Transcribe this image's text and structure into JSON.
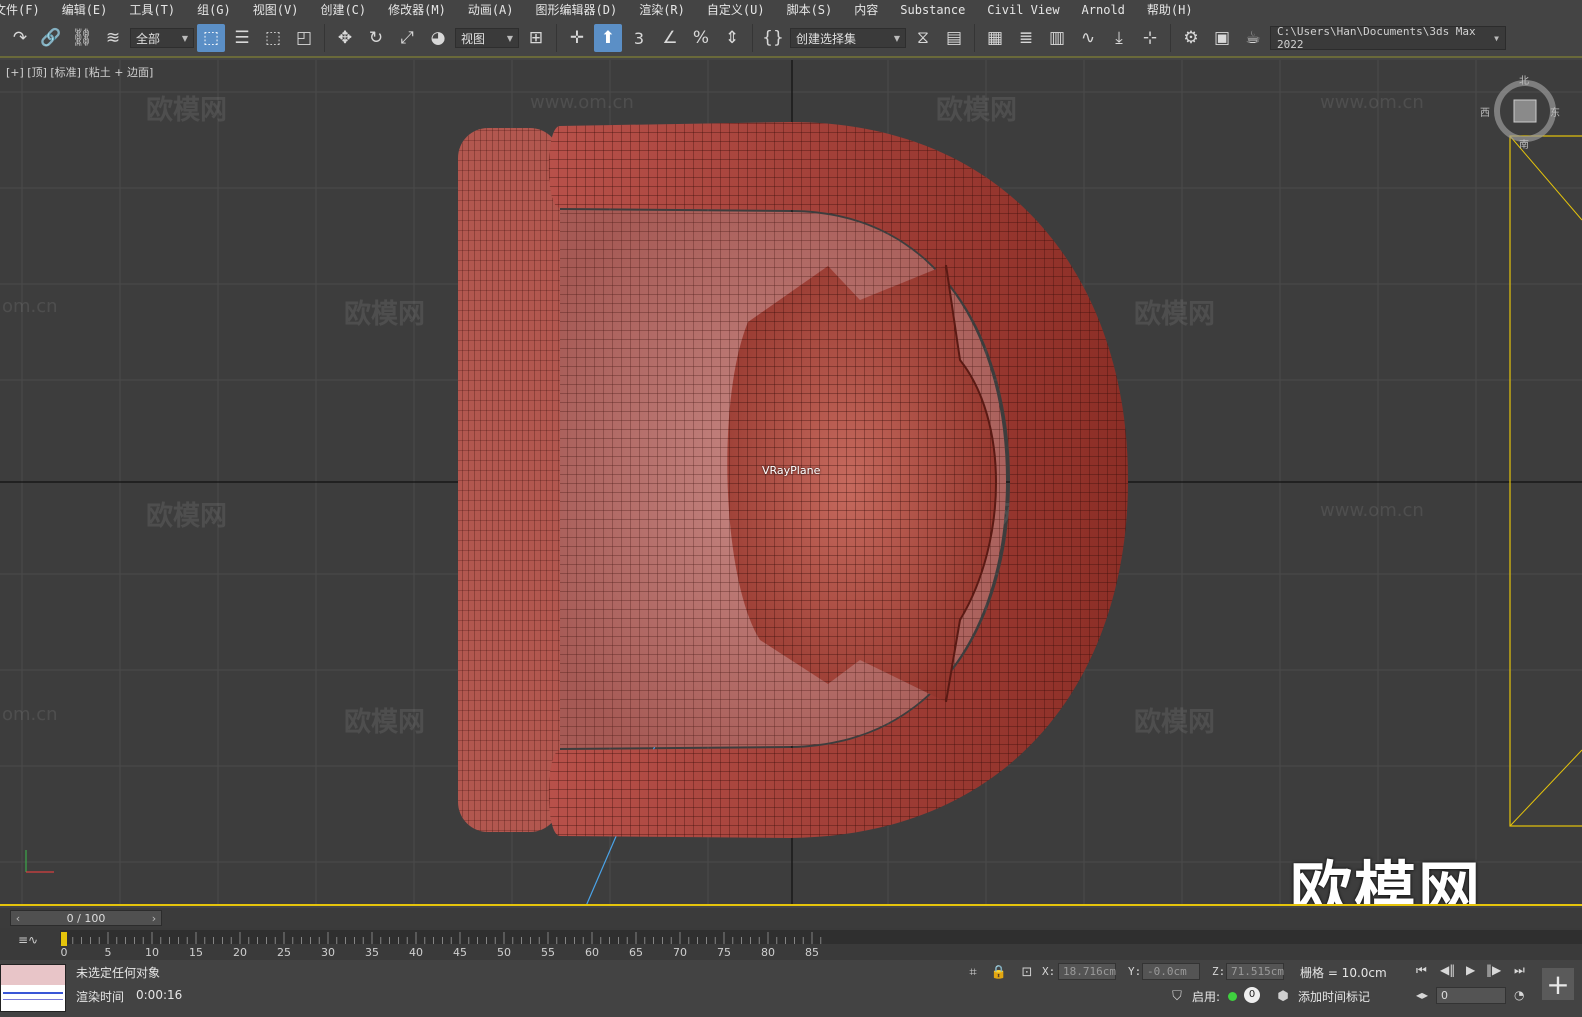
{
  "menu": [
    "文件(F)",
    "编辑(E)",
    "工具(T)",
    "组(G)",
    "视图(V)",
    "创建(C)",
    "修改器(M)",
    "动画(A)",
    "图形编辑器(D)",
    "渲染(R)",
    "自定义(U)",
    "脚本(S)",
    "内容",
    "Substance",
    "Civil View",
    "Arnold",
    "帮助(H)"
  ],
  "toolbar": {
    "filter_value": "全部",
    "refcoord_value": "视图",
    "selset_placeholder": "创建选择集",
    "project_path": "C:\\Users\\Han\\Documents\\3ds Max 2022"
  },
  "viewport": {
    "label": "[+] [顶] [标准] [粘土 + 边面]",
    "object_label": "VRayPlane",
    "watermark_cn": "欧模网",
    "watermark_url": "www.om.cn",
    "watermark_url_short": "om.cn",
    "big_watermark": "欧模网",
    "viewcube": {
      "north": "北",
      "east": "东",
      "west": "西",
      "south": "南"
    }
  },
  "timeslider": {
    "value": "0 / 100"
  },
  "trackbar": {
    "ticks": [
      0,
      5,
      10,
      15,
      20,
      25,
      30,
      35,
      40,
      45,
      50,
      55,
      60,
      65,
      70,
      75,
      80,
      85
    ]
  },
  "status": {
    "selection": "未选定任何对象",
    "render_time_label": "渲染时间",
    "render_time_value": "0:00:16",
    "x_label": "X:",
    "x_value": "18.716cm",
    "y_label": "Y:",
    "y_value": "-0.0cm",
    "z_label": "Z:",
    "z_value": "71.515cm",
    "grid_label": "栅格 = 10.0cm",
    "enable_label": "启用:",
    "enable_count": "0",
    "add_time_tag": "添加时间标记",
    "frame_value": "0"
  },
  "colors": {
    "accent": "#5b8fc6",
    "selection_border": "#e5c40b",
    "model": "#a9453a"
  }
}
